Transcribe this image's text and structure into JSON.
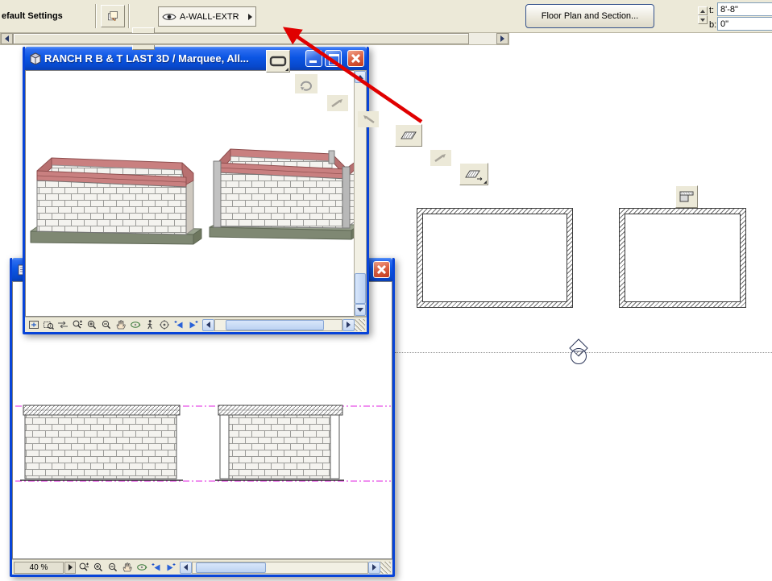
{
  "toolbar": {
    "settings_label": "efault Settings",
    "layer_combo": "A-WALL-EXTR",
    "floor_plan_section_button": "Floor Plan and Section...",
    "fields": {
      "t_label": "t:",
      "t_value": "8'-8\"",
      "b_label": "b:",
      "b_value": "0\""
    }
  },
  "window_3d": {
    "title": "RANCH R B & T LAST 3D / Marquee, All..."
  },
  "window_elevation": {
    "zoom_level": "40 %"
  },
  "colors": {
    "toolbar_bg": "#ECE9D8",
    "titlebar_blue": "#0B52DE",
    "window_border_blue": "#0844D8",
    "close_button_red": "#D2492E",
    "guide_magenta": "#E020E0",
    "annotation_arrow_red": "#E00000",
    "brick_accent_pink": "#C98080"
  }
}
